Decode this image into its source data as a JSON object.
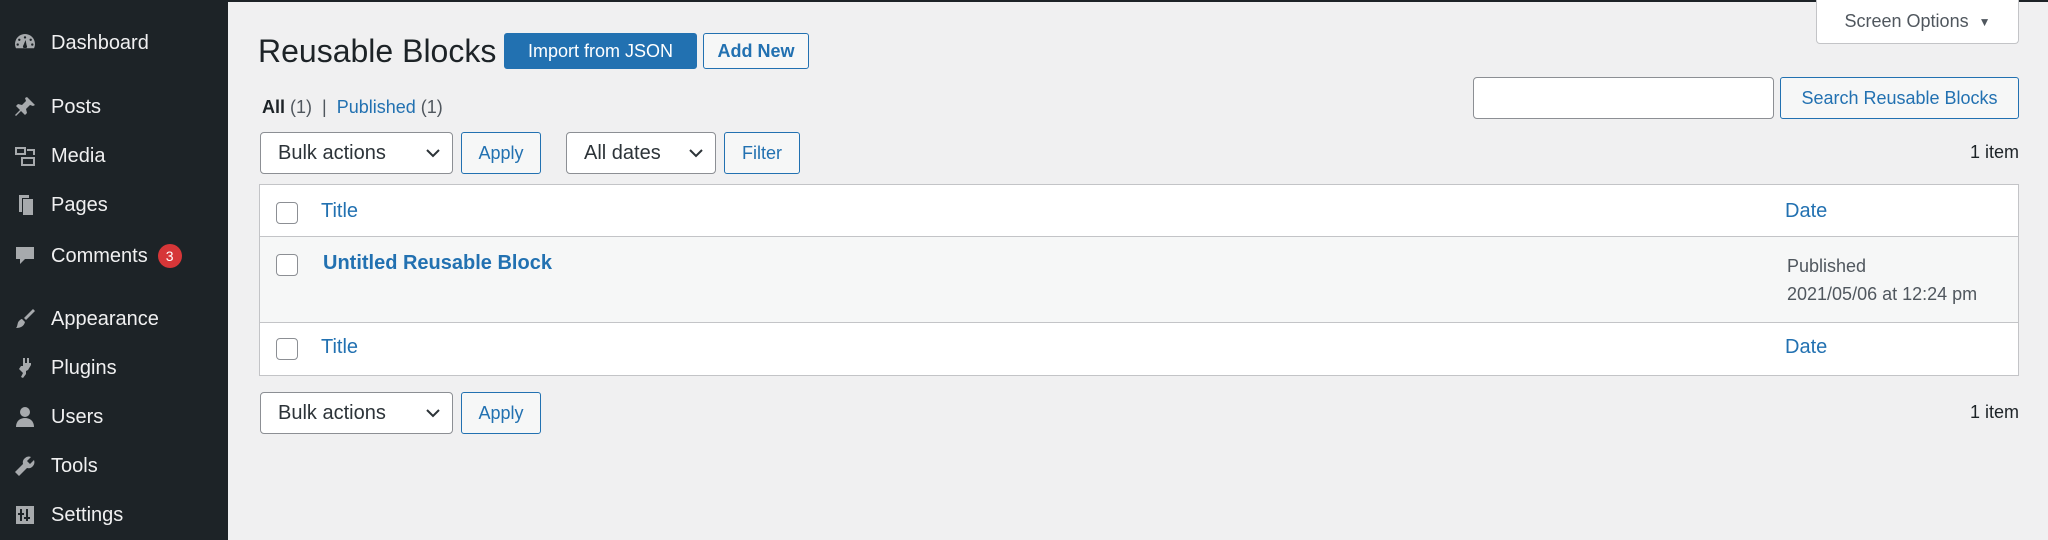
{
  "sidebar": {
    "items": [
      {
        "label": "Dashboard",
        "icon": "dashboard-icon"
      },
      {
        "label": "Posts",
        "icon": "pin-icon"
      },
      {
        "label": "Media",
        "icon": "media-icon"
      },
      {
        "label": "Pages",
        "icon": "pages-icon"
      },
      {
        "label": "Comments",
        "icon": "comment-icon",
        "badge": "3"
      },
      {
        "label": "Appearance",
        "icon": "brush-icon"
      },
      {
        "label": "Plugins",
        "icon": "plugin-icon"
      },
      {
        "label": "Users",
        "icon": "user-icon"
      },
      {
        "label": "Tools",
        "icon": "wrench-icon"
      },
      {
        "label": "Settings",
        "icon": "settings-icon"
      }
    ]
  },
  "screen_options": {
    "label": "Screen Options",
    "caret": "▼"
  },
  "header": {
    "title": "Reusable Blocks",
    "import_label": "Import from JSON",
    "add_new_label": "Add New"
  },
  "views": {
    "all_label": "All",
    "all_count": "(1)",
    "separator": "|",
    "published_label": "Published",
    "published_count": "(1)"
  },
  "search": {
    "value": "",
    "button_label": "Search Reusable Blocks"
  },
  "tablenav_top": {
    "bulk_actions": "Bulk actions",
    "apply_label": "Apply",
    "dates": "All dates",
    "filter_label": "Filter",
    "items_count": "1 item"
  },
  "table": {
    "columns": {
      "title": "Title",
      "date": "Date"
    },
    "rows": [
      {
        "title": "Untitled Reusable Block",
        "status": "Published",
        "date": "2021/05/06 at 12:24 pm"
      }
    ]
  },
  "tablenav_bottom": {
    "bulk_actions": "Bulk actions",
    "apply_label": "Apply",
    "items_count": "1 item"
  },
  "colors": {
    "sidebar_bg": "#1d2327",
    "accent": "#2271b1",
    "badge": "#d63638",
    "page_bg": "#f0f0f1"
  }
}
